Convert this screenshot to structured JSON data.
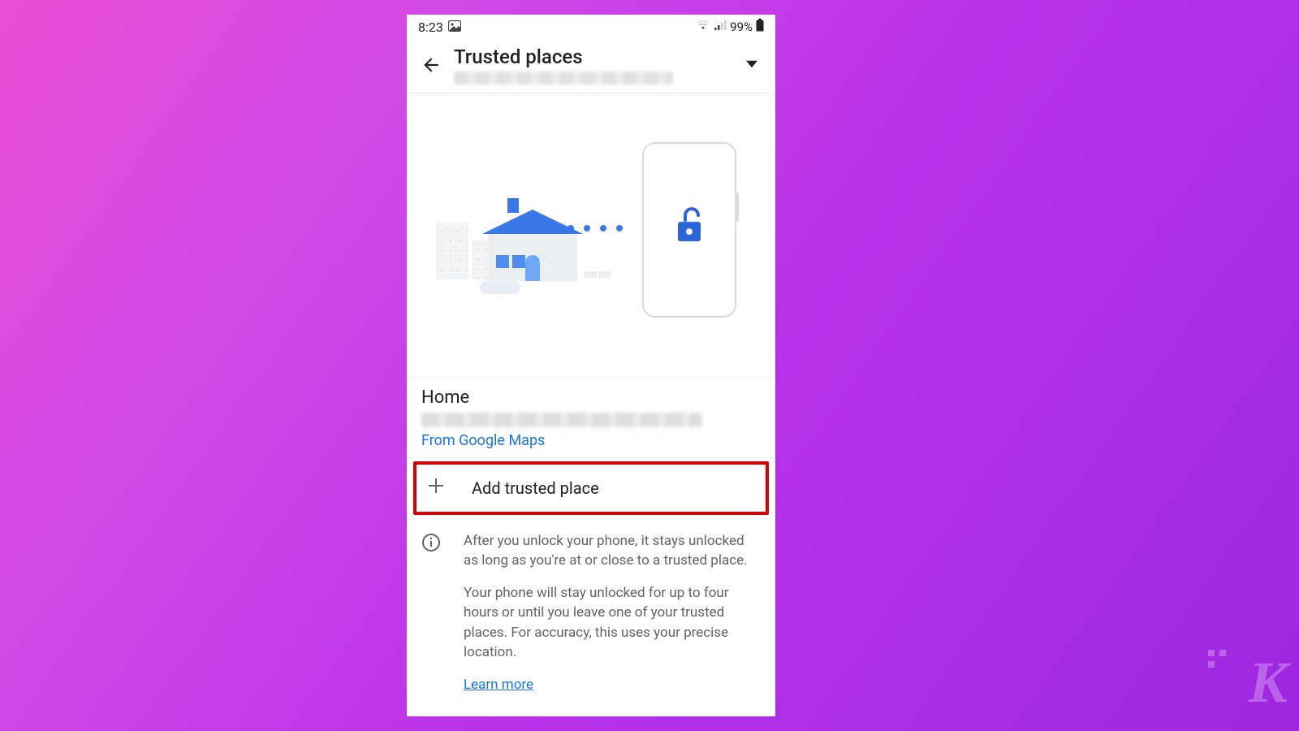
{
  "status": {
    "time": "8:23",
    "battery": "99%"
  },
  "header": {
    "title": "Trusted places"
  },
  "places": [
    {
      "name": "Home",
      "source": "From Google Maps"
    }
  ],
  "actions": {
    "add_label": "Add trusted place"
  },
  "info": {
    "p1": "After you unlock your phone, it stays unlocked as long as you're at or close to a trusted place.",
    "p2": "Your phone will stay unlocked for up to four hours or until you leave one of your trusted places. For accuracy, this uses your precise location.",
    "learn_more": "Learn more"
  }
}
